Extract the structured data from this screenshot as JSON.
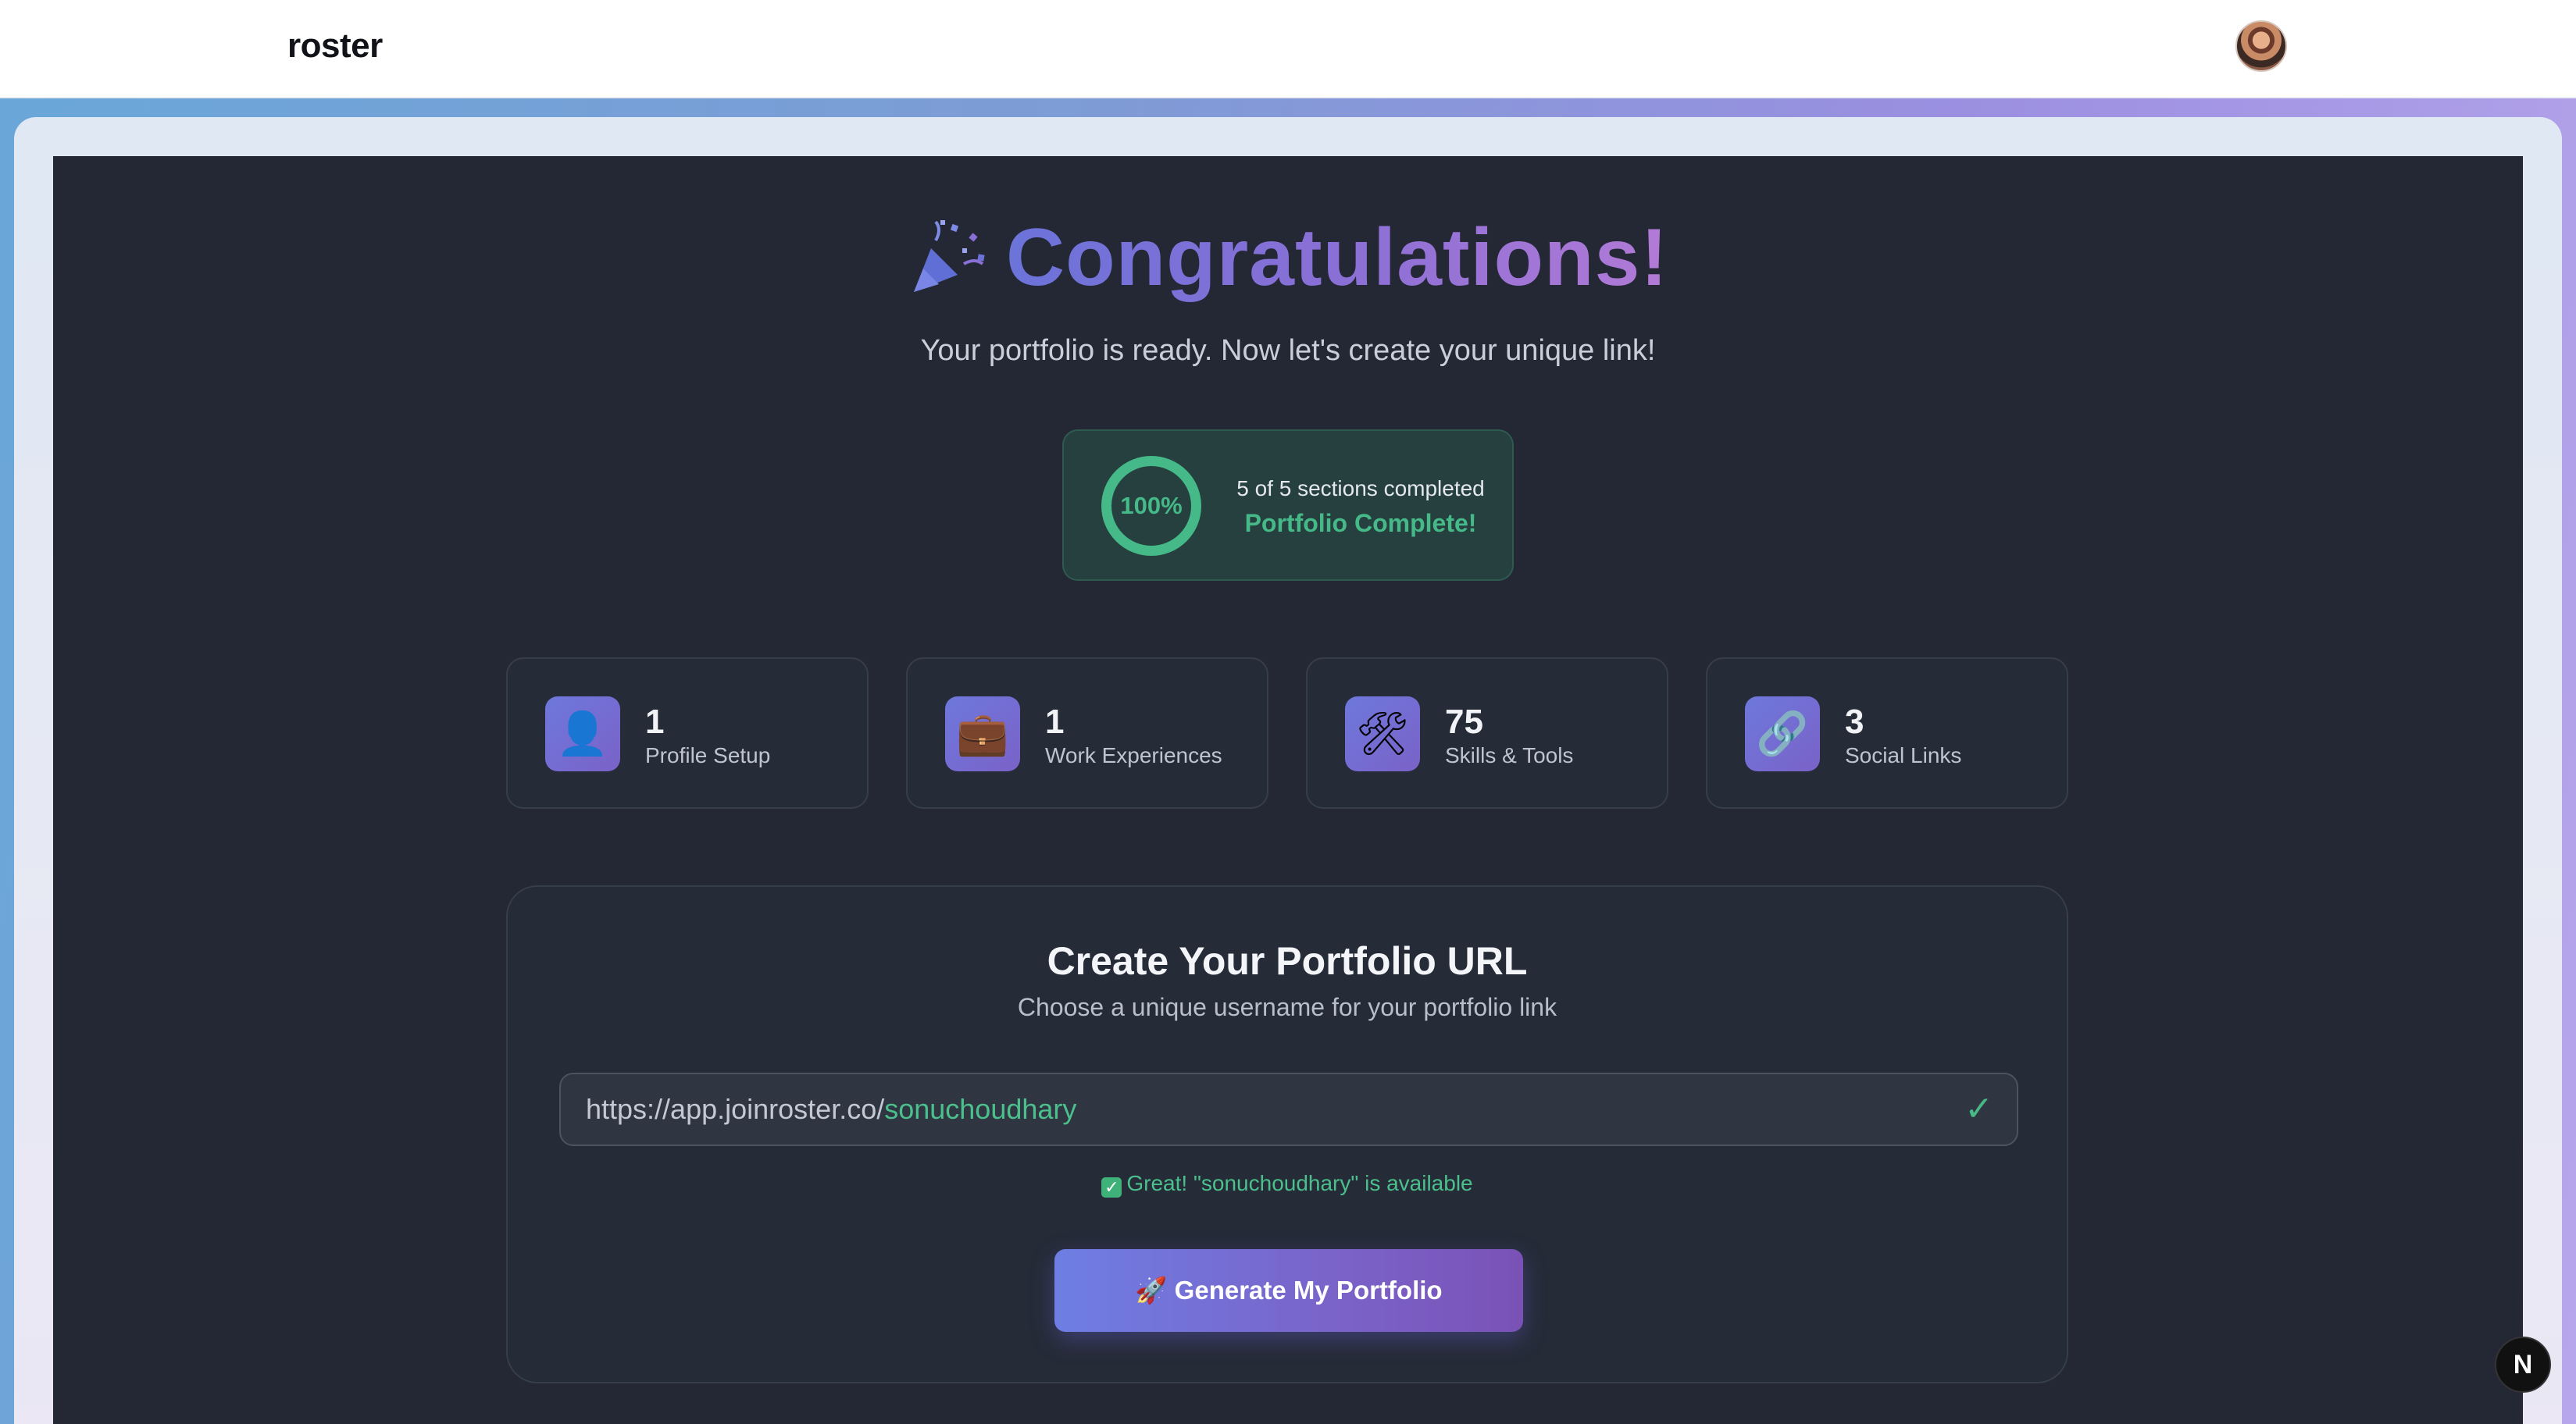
{
  "navbar": {
    "brand": "roster"
  },
  "hero": {
    "icon": "party-popper-icon",
    "title": "Congratulations!",
    "subtitle": "Your portfolio is ready. Now let's create your unique link!"
  },
  "progress": {
    "percent_label": "100%",
    "percent_value": 100,
    "sections_text": "5 of 5 sections completed",
    "status": "Portfolio Complete!"
  },
  "stats": [
    {
      "icon": "👤",
      "icon_name": "person-icon",
      "count": "1",
      "label": "Profile Setup"
    },
    {
      "icon": "💼",
      "icon_name": "briefcase-icon",
      "count": "1",
      "label": "Work Experiences"
    },
    {
      "icon": "🛠",
      "icon_name": "tools-icon",
      "count": "75",
      "label": "Skills & Tools"
    },
    {
      "icon": "🔗",
      "icon_name": "link-icon",
      "count": "3",
      "label": "Social Links"
    }
  ],
  "url_section": {
    "title": "Create Your Portfolio URL",
    "subtitle": "Choose a unique username for your portfolio link",
    "url_prefix": "https://app.joinroster.co/",
    "username": "sonuchoudhary",
    "check_mark": "✓",
    "availability": "Great! \"sonuchoudhary\" is available",
    "button_label": "🚀 Generate My Portfolio"
  },
  "badge": {
    "label": "N"
  },
  "colors": {
    "accent": "#6e78dc",
    "success": "#45b987",
    "panel": "#232834"
  }
}
